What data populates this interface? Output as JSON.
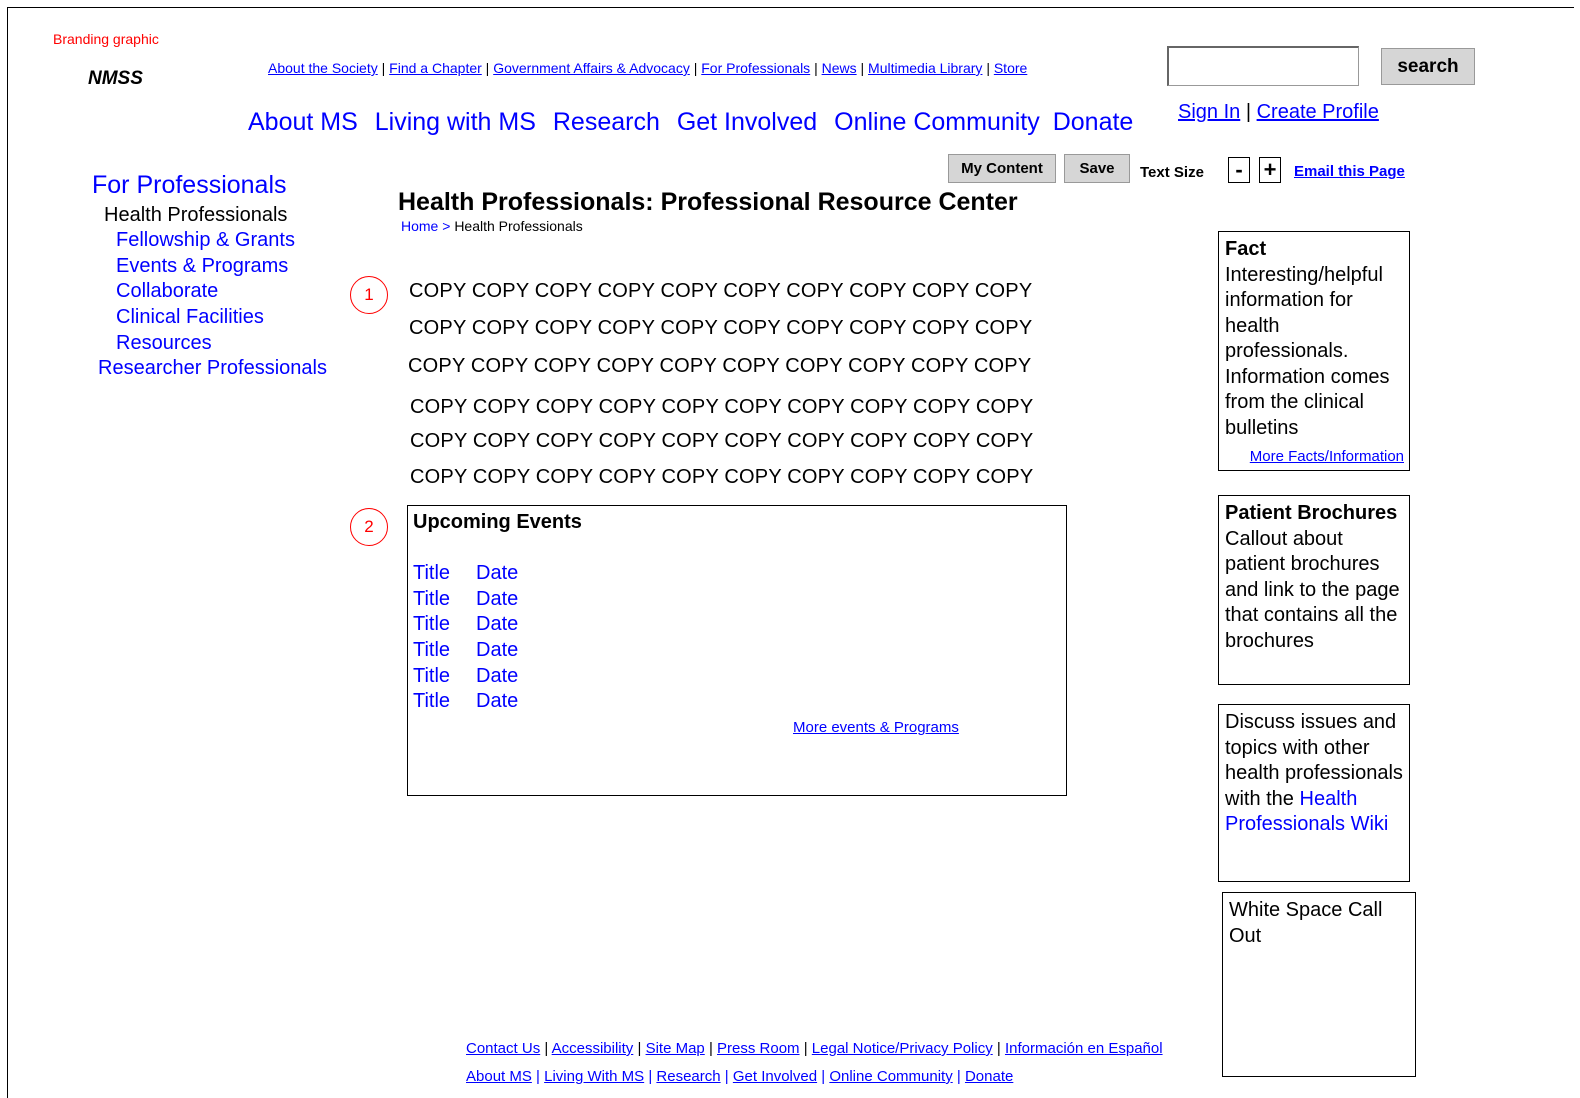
{
  "header": {
    "branding": "Branding graphic",
    "logo_text": "NMSS",
    "utility_links": [
      "About the Society",
      "Find a Chapter",
      "Government Affairs & Advocacy",
      "For Professionals",
      "News",
      "Multimedia Library",
      "Store"
    ],
    "search": {
      "placeholder": "",
      "button": "search"
    },
    "main_nav": [
      "About MS",
      "Living with MS",
      "Research",
      "Get Involved",
      "Online Community",
      "Donate"
    ],
    "sign_in": "Sign In",
    "create_profile": "Create Profile",
    "separator": "|"
  },
  "toolbar": {
    "my_content": "My Content",
    "save": "Save",
    "text_size": "Text Size",
    "decrease": "-",
    "increase": "+",
    "email": "Email this Page"
  },
  "leftnav": {
    "title": "For Professionals",
    "section": "Health Professionals",
    "items": [
      "Fellowship & Grants",
      "Events & Programs",
      "Collaborate",
      "Clinical Facilities",
      "Resources"
    ],
    "other": "Researcher Professionals"
  },
  "main": {
    "title": "Health Professionals: Professional Resource Center",
    "breadcrumb_home": "Home >",
    "breadcrumb_current": "Health Professionals",
    "markers": [
      "1",
      "2"
    ],
    "copy_lines": [
      "COPY COPY COPY COPY COPY COPY COPY COPY COPY COPY",
      "COPY COPY COPY COPY COPY COPY COPY COPY COPY COPY",
      "COPY COPY COPY COPY COPY COPY COPY COPY COPY COPY",
      "COPY COPY COPY COPY COPY COPY COPY COPY COPY COPY",
      "COPY COPY COPY COPY COPY COPY COPY COPY COPY COPY",
      "COPY COPY COPY COPY COPY COPY COPY COPY COPY COPY"
    ],
    "events": {
      "title": "Upcoming Events",
      "rows": [
        {
          "title": "Title",
          "date": "Date"
        },
        {
          "title": "Title",
          "date": "Date"
        },
        {
          "title": "Title",
          "date": "Date"
        },
        {
          "title": "Title",
          "date": "Date"
        },
        {
          "title": "Title",
          "date": "Date"
        },
        {
          "title": "Title",
          "date": "Date"
        }
      ],
      "more": "More events & Programs"
    }
  },
  "sidebar": {
    "fact": {
      "title": "Fact",
      "body": "Interesting/helpful information for health professionals. Information comes from the clinical bulletins",
      "more": "More Facts/Information"
    },
    "brochures": {
      "title": "Patient Brochures",
      "body": "Callout about patient brochures and link to the page that contains all the brochures"
    },
    "wiki": {
      "body": "Discuss issues and topics with other health professionals with the",
      "link": "Health Professionals Wiki"
    },
    "whitespace": {
      "body": "White Space Call Out"
    }
  },
  "footer": {
    "links1": [
      "Contact Us",
      "Accessibility",
      "Site Map",
      "Press Room",
      "Legal Notice/Privacy Policy",
      "Información en Español"
    ],
    "links2": [
      "About MS",
      "Living With MS",
      "Research",
      "Get Involved",
      "Online Community",
      "Donate"
    ]
  }
}
